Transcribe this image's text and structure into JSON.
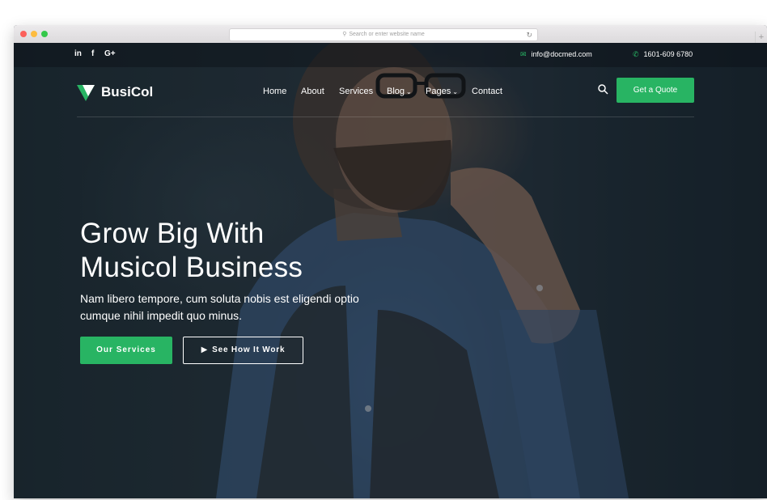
{
  "browser": {
    "url_placeholder": "Search or enter website name",
    "reload_icon": "reload-icon",
    "new_tab_label": "+"
  },
  "topbar": {
    "social": [
      "in",
      "f",
      "G+"
    ],
    "email": "info@docmed.com",
    "phone": "1601-609 6780"
  },
  "navbar": {
    "logo_text": "BusiCol",
    "menu": [
      {
        "label": "Home"
      },
      {
        "label": "About"
      },
      {
        "label": "Services"
      },
      {
        "label": "Blog",
        "dropdown": true
      },
      {
        "label": "Pages",
        "dropdown": true
      },
      {
        "label": "Contact"
      }
    ],
    "cta_label": "Get a Quote"
  },
  "hero": {
    "title_line1": "Grow Big With",
    "title_line2": "Musicol Business",
    "subtitle_line1": "Nam libero tempore, cum soluta nobis est eligendi optio",
    "subtitle_line2": "cumque nihil impedit quo minus.",
    "primary_button": "Our Services",
    "secondary_button": "See How It Work"
  },
  "colors": {
    "accent": "#28b463",
    "text": "#ffffff",
    "overlay": "#1b2731"
  }
}
